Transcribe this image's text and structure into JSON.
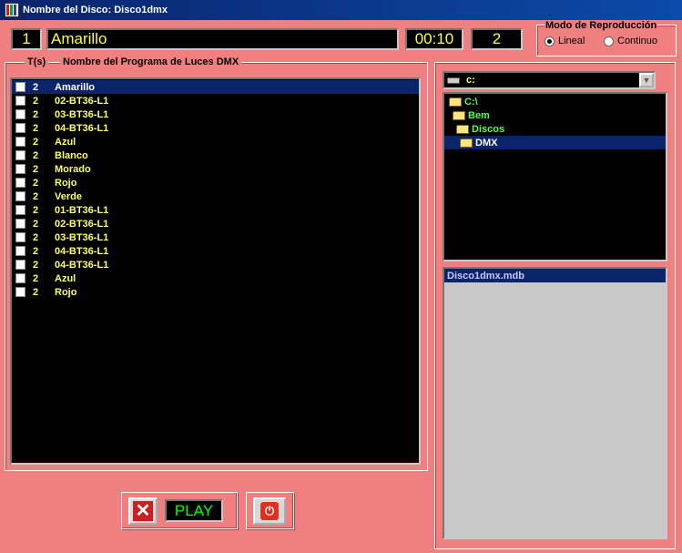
{
  "window": {
    "title": "Nombre del Disco: Disco1dmx"
  },
  "status": {
    "track_number": "1",
    "program_name": "Amarillo",
    "time": "00:10",
    "count": "2"
  },
  "mode": {
    "legend": "Modo de Reproducción",
    "options": [
      {
        "label": "Lineal",
        "selected": true
      },
      {
        "label": "Continuo",
        "selected": false
      }
    ]
  },
  "program_list": {
    "headers": {
      "time": "T(s)",
      "name": "Nombre del Programa de Luces DMX"
    },
    "rows": [
      {
        "t": "2",
        "name": "Amarillo",
        "checked": false
      },
      {
        "t": "2",
        "name": "02-BT36-L1",
        "checked": false
      },
      {
        "t": "2",
        "name": "03-BT36-L1",
        "checked": false
      },
      {
        "t": "2",
        "name": "04-BT36-L1",
        "checked": false
      },
      {
        "t": "2",
        "name": "Azul",
        "checked": false
      },
      {
        "t": "2",
        "name": "Blanco",
        "checked": false
      },
      {
        "t": "2",
        "name": "Morado",
        "checked": false
      },
      {
        "t": "2",
        "name": "Rojo",
        "checked": false
      },
      {
        "t": "2",
        "name": "Verde",
        "checked": false
      },
      {
        "t": "2",
        "name": "01-BT36-L1",
        "checked": false
      },
      {
        "t": "2",
        "name": "02-BT36-L1",
        "checked": false
      },
      {
        "t": "2",
        "name": "03-BT36-L1",
        "checked": false
      },
      {
        "t": "2",
        "name": "04-BT36-L1",
        "checked": false
      },
      {
        "t": "2",
        "name": "04-BT36-L1",
        "checked": false
      },
      {
        "t": "2",
        "name": "Azul",
        "checked": false
      },
      {
        "t": "2",
        "name": "Rojo",
        "checked": false
      }
    ]
  },
  "controls": {
    "play_label": "PLAY",
    "stop_icon": "close-icon",
    "power_icon": "power-icon"
  },
  "drive": {
    "value": "c:"
  },
  "directories": [
    {
      "label": "C:\\"
    },
    {
      "label": "Bem"
    },
    {
      "label": "Discos"
    },
    {
      "label": "DMX"
    }
  ],
  "files": [
    {
      "label": "Disco1dmx.mdb"
    }
  ],
  "colors": {
    "background": "#f08080",
    "lcd_text": "#ffff40",
    "selection": "#0a246a",
    "folder_text": "#55ff55",
    "play_text": "#00ff00"
  }
}
